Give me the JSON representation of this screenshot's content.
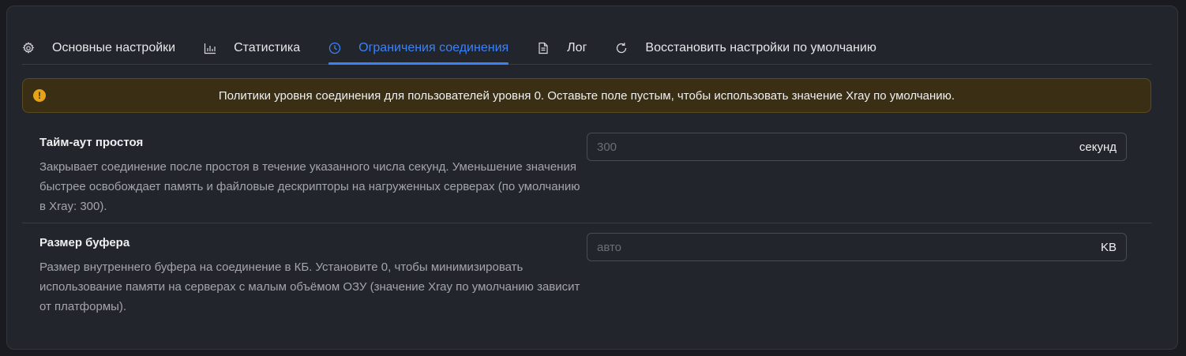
{
  "tabs": [
    {
      "label": "Основные настройки",
      "icon": "gear-icon"
    },
    {
      "label": "Статистика",
      "icon": "bar-chart-icon"
    },
    {
      "label": "Ограничения соединения",
      "icon": "clock-icon",
      "active": true
    },
    {
      "label": "Лог",
      "icon": "document-icon"
    },
    {
      "label": "Восстановить настройки по умолчанию",
      "icon": "reset-icon"
    }
  ],
  "alert": {
    "icon": "exclamation-icon",
    "text": "Политики уровня соединения для пользователей уровня 0. Оставьте поле пустым, чтобы использовать значение Xray по умолчанию."
  },
  "settings": {
    "idle_timeout": {
      "title": "Тайм-аут простоя",
      "description": "Закрывает соединение после простоя в течение указанного числа секунд. Уменьшение значения быстрее освобождает память и файловые дескрипторы на нагруженных серверах (по умолчанию в Xray: 300).",
      "placeholder": "300",
      "value": "",
      "suffix": "секунд"
    },
    "buffer_size": {
      "title": "Размер буфера",
      "description": "Размер внутреннего буфера на соединение в КБ. Установите 0, чтобы минимизировать использование памяти на серверах с малым объёмом ОЗУ (значение Xray по умолчанию зависит от платформы).",
      "placeholder": "авто",
      "value": "",
      "suffix": "KB"
    }
  },
  "colors": {
    "accent": "#3b82f6",
    "warning": "#e6a317",
    "card_bg": "#23252c"
  }
}
